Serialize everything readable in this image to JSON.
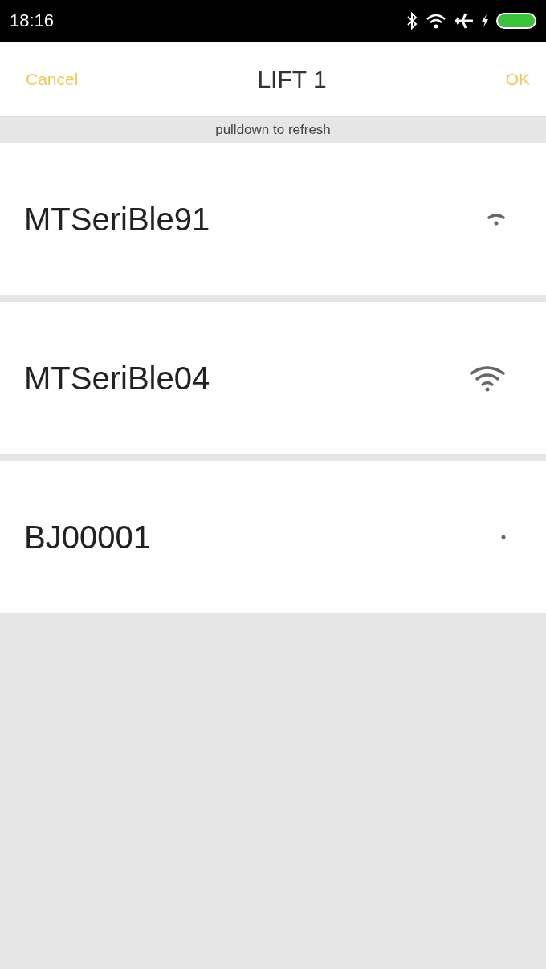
{
  "status_bar": {
    "time": "18:16"
  },
  "header": {
    "cancel": "Cancel",
    "title": "LIFT 1",
    "ok": "OK"
  },
  "refresh_hint": "pulldown to refresh",
  "devices": [
    {
      "name": "MTSeriBle91",
      "kind": "weak"
    },
    {
      "name": "MTSeriBle04",
      "kind": "strong"
    },
    {
      "name": "BJ00001",
      "kind": "faint"
    }
  ]
}
